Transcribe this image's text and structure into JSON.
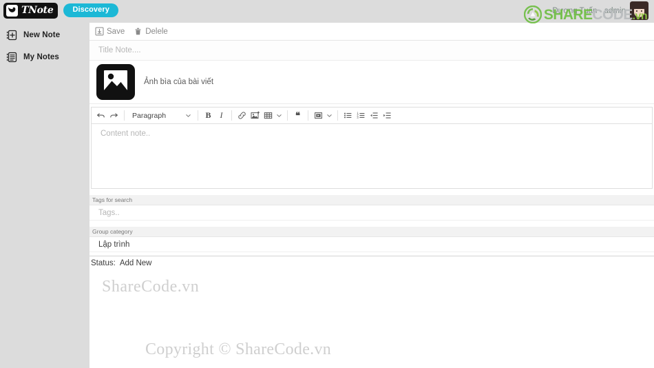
{
  "header": {
    "logo_text": "TNote",
    "logo_icon": "bird-icon",
    "discovery_label": "Discovery",
    "user_name": "Dương Tuấn - admin",
    "avatar_icon": "user-avatar"
  },
  "watermark": {
    "brand_share": "SHARE",
    "brand_code": "CODE",
    "brand_vn": ".vn",
    "center_text": "ShareCode.vn",
    "copyright_text": "Copyright © ShareCode.vn",
    "logo_icon": "recycle-leaf-icon"
  },
  "sidebar": {
    "items": [
      {
        "label": "New Note",
        "icon": "new-note-icon"
      },
      {
        "label": "My Notes",
        "icon": "my-notes-icon"
      }
    ]
  },
  "actionbar": {
    "save_label": "Save",
    "save_icon": "save-icon",
    "delete_label": "Delele",
    "delete_icon": "trash-icon"
  },
  "note": {
    "title_placeholder": "Title Note....",
    "title_value": "",
    "cover_label": "Ảnh bìa của bài viết",
    "cover_icon": "image-placeholder-icon",
    "content_placeholder": "Content note..",
    "content_value": ""
  },
  "editor": {
    "undo_icon": "undo-icon",
    "redo_icon": "redo-icon",
    "block_format": "Paragraph",
    "bold_label": "B",
    "italic_label": "I",
    "link_icon": "link-icon",
    "image_icon": "insert-image-icon",
    "table_icon": "table-icon",
    "quote_label": "❝",
    "media_icon": "insert-media-icon",
    "bullet_list_icon": "bullet-list-icon",
    "numbered_list_icon": "numbered-list-icon",
    "outdent_icon": "outdent-icon",
    "indent_icon": "indent-icon",
    "chevron_icon": "chevron-down-icon"
  },
  "fields": {
    "tags_label": "Tags for search",
    "tags_placeholder": "Tags..",
    "tags_value": "",
    "category_label": "Group category",
    "category_value": "Lập trình"
  },
  "status": {
    "label": "Status:",
    "value": "Add New"
  },
  "colors": {
    "chrome_gray": "#dcdcdc",
    "accent_cyan": "#1cb8d6",
    "brand_green": "#6fbe44",
    "watermark_gray": "#cfcfcf"
  }
}
